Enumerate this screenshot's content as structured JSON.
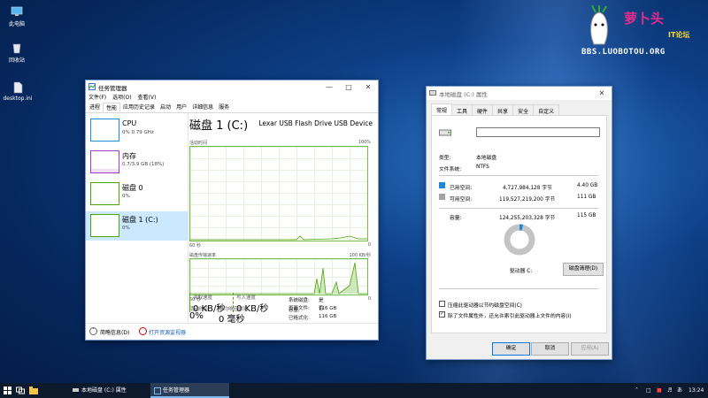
{
  "desktop": {
    "icons": [
      {
        "label": "此电脑",
        "icon": "computer-icon"
      },
      {
        "label": "回收站",
        "icon": "recycle-bin-icon"
      },
      {
        "label": "desktop.ini",
        "icon": "file-icon"
      }
    ],
    "watermark": {
      "title": "萝卜头",
      "subtitle": "IT论坛",
      "url": "BBS.LUOBOTOU.ORG"
    }
  },
  "task_manager": {
    "title": "任务管理器",
    "menu": [
      "文件(F)",
      "选项(O)",
      "查看(V)"
    ],
    "tabs": [
      "进程",
      "性能",
      "应用历史记录",
      "启动",
      "用户",
      "详细信息",
      "服务"
    ],
    "active_tab": "性能",
    "resources": [
      {
        "name": "CPU",
        "value": "0% 0.79 GHz",
        "color": "#1d8fd6"
      },
      {
        "name": "内存",
        "value": "0.7/3.9 GB (18%)",
        "color": "#a33fc4"
      },
      {
        "name": "磁盘 0",
        "value": "0%",
        "color": "#4da60c"
      },
      {
        "name": "磁盘 1 (C:)",
        "value": "0%",
        "color": "#4da60c",
        "selected": true
      }
    ],
    "detail": {
      "title": "磁盘 1 (C:)",
      "model": "Lexar USB Flash Drive USB Device",
      "graph1_label": "活动时间",
      "graph1_max": "100%",
      "graph1_xlabel": "60 秒",
      "graph1_xmin": "0",
      "graph2_label": "磁盘传输速率",
      "graph2_max": "100 KB/秒",
      "graph2_xlabel": "60 秒",
      "graph2_xmin": "0",
      "activity_label": "活动时间",
      "activity_value": "0%",
      "response_label": "平均响应时间",
      "response_value": "0 毫秒",
      "read_label": "读取速度",
      "read_value": "0 KB/秒",
      "write_label": "写入速度",
      "write_value": "0 KB/秒",
      "props": [
        {
          "k": "容量:",
          "v": "116 GB"
        },
        {
          "k": "已格式化:",
          "v": "116 GB"
        },
        {
          "k": "系统磁盘:",
          "v": "是"
        },
        {
          "k": "页面文件:",
          "v": "否"
        }
      ]
    },
    "footer": {
      "less_details": "简略信息(D)",
      "open_monitor": "打开资源监视器"
    }
  },
  "properties": {
    "title": "本地磁盘 (C:) 属性",
    "tabs": [
      "常规",
      "工具",
      "硬件",
      "共享",
      "安全",
      "自定义"
    ],
    "active_tab": "常规",
    "name_value": "",
    "type_label": "类型:",
    "type_value": "本地磁盘",
    "fs_label": "文件系统:",
    "fs_value": "NTFS",
    "used": {
      "label": "已用空间:",
      "bytes": "4,727,984,128 字节",
      "size": "4.40 GB",
      "color": "#1e88d8"
    },
    "free": {
      "label": "可用空间:",
      "bytes": "119,527,219,200 字节",
      "size": "111 GB",
      "color": "#a3a3a3"
    },
    "capacity": {
      "label": "容量:",
      "bytes": "124,255,203,328 字节",
      "size": "115 GB"
    },
    "used_fraction": 0.038,
    "drive_label": "驱动器 C:",
    "cleanup_button": "磁盘清理(D)",
    "compress_label": "压缩此驱动器以节约磁盘空间(C)",
    "compress_checked": false,
    "index_label": "除了文件属性外，还允许索引此驱动器上文件的内容(I)",
    "index_checked": true,
    "ok": "确定",
    "cancel": "取消",
    "apply": "应用(A)"
  },
  "taskbar": {
    "items": [
      {
        "label": "本地磁盘 (C:) 属性",
        "active": false
      },
      {
        "label": "任务管理器",
        "active": true
      }
    ],
    "time": "13:24"
  }
}
